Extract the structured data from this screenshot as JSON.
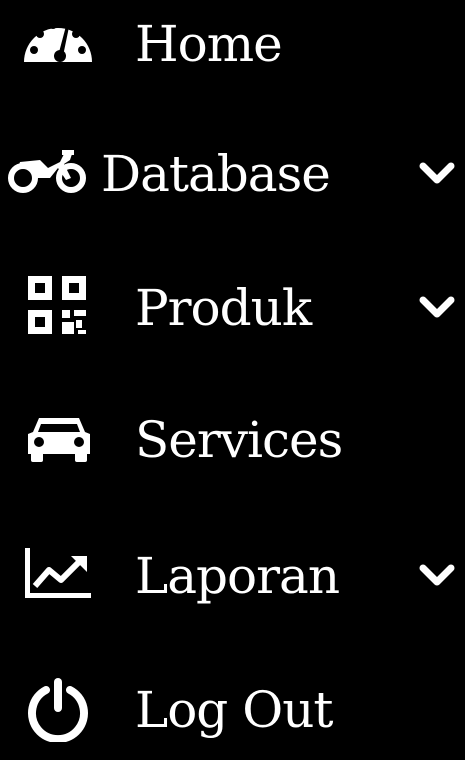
{
  "sidebar": {
    "items": [
      {
        "label": "Home",
        "icon": "speedometer-icon",
        "has_submenu": false
      },
      {
        "label": "Database",
        "icon": "motorcycle-icon",
        "has_submenu": true
      },
      {
        "label": "Produk",
        "icon": "qrcode-icon",
        "has_submenu": true
      },
      {
        "label": "Services",
        "icon": "car-icon",
        "has_submenu": false
      },
      {
        "label": "Laporan",
        "icon": "chart-line-icon",
        "has_submenu": true
      },
      {
        "label": "Log Out",
        "icon": "power-icon",
        "has_submenu": false
      }
    ]
  },
  "colors": {
    "background": "#000000",
    "foreground": "#ffffff"
  }
}
